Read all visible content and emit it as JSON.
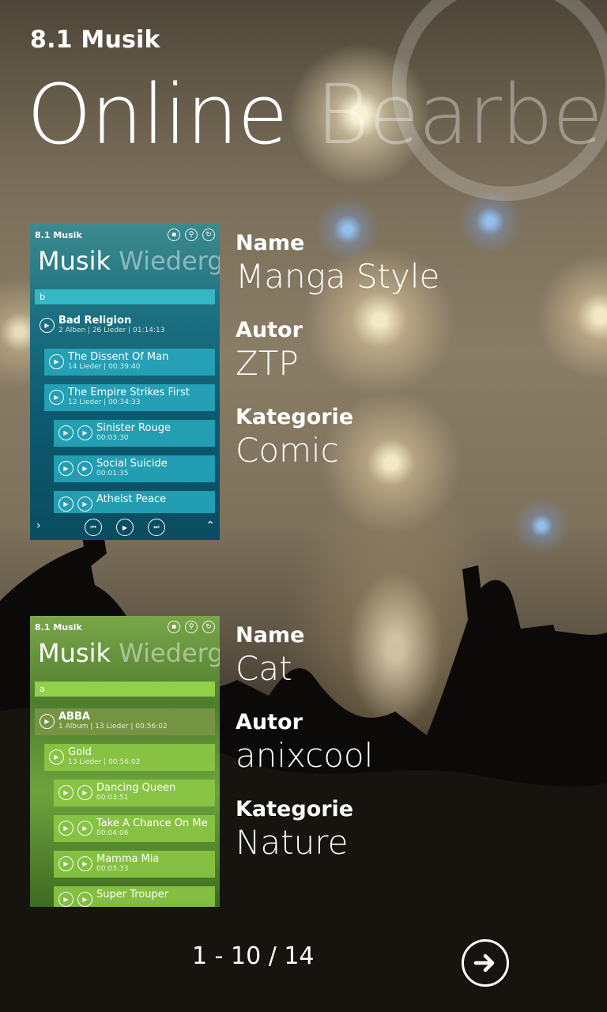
{
  "app": {
    "title": "8.1 Musik"
  },
  "pivot": {
    "active": "Online",
    "next": "Bearbeiten"
  },
  "labels": {
    "name": "Name",
    "author": "Autor",
    "category": "Kategorie"
  },
  "themes": [
    {
      "name": "Manga Style",
      "author": "ZTP",
      "category": "Comic",
      "preview": {
        "app_title": "8.1 Musik",
        "title_main": "Musik",
        "title_next": "Wiedergabe",
        "search": "b",
        "rows": [
          {
            "title": "Bad Religion",
            "sub": "2 Alben | 26 Lieder | 01:14:13"
          },
          {
            "title": "The Dissent Of Man",
            "sub": "14 Lieder | 00:39:40"
          },
          {
            "title": "The Empire Strikes First",
            "sub": "12 Lieder | 00:34:33"
          },
          {
            "title": "Sinister Rouge",
            "sub": "00:03:30"
          },
          {
            "title": "Social Suicide",
            "sub": "00:01:35"
          },
          {
            "title": "Atheist Peace",
            "sub": ""
          }
        ]
      }
    },
    {
      "name": "Cat",
      "author": "anixcool",
      "category": "Nature",
      "preview": {
        "app_title": "8.1 Musik",
        "title_main": "Musik",
        "title_next": "Wiedergabe",
        "search": "a",
        "rows": [
          {
            "title": "ABBA",
            "sub": "1 Album | 13 Lieder | 00:56:02"
          },
          {
            "title": "Gold",
            "sub": "13 Lieder | 00:56:02"
          },
          {
            "title": "Dancing Queen",
            "sub": "00:03:51"
          },
          {
            "title": "Take A Chance On Me",
            "sub": "00:04:06"
          },
          {
            "title": "Mamma Mia",
            "sub": "00:03:33"
          },
          {
            "title": "Super Trouper",
            "sub": ""
          }
        ]
      }
    }
  ],
  "pager": {
    "text": "1 - 10 / 14"
  },
  "colors": {
    "accent_blue": "#35b7c8",
    "accent_green": "#93d04a"
  }
}
